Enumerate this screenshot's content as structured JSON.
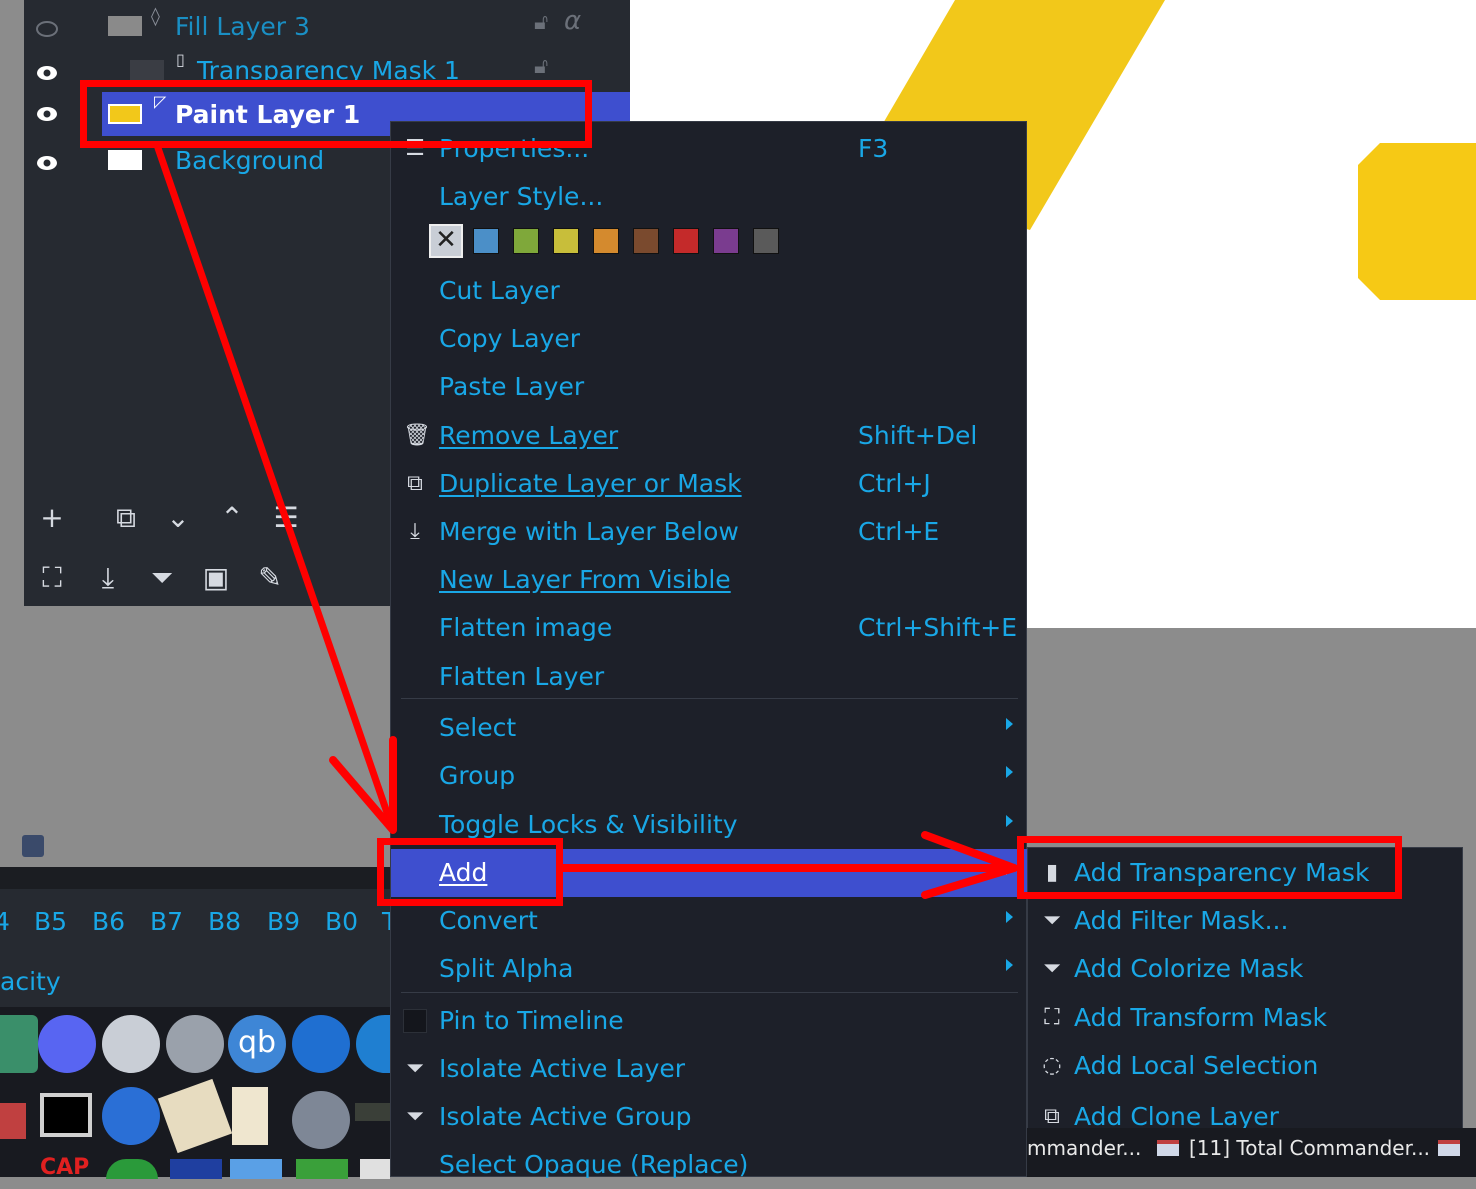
{
  "layers": [
    {
      "name": "Fill Layer 3",
      "selected": false
    },
    {
      "name": "Transparency Mask 1",
      "selected": false
    },
    {
      "name": "Paint Layer 1",
      "selected": true
    },
    {
      "name": "Background",
      "selected": false
    }
  ],
  "brush_tabs": [
    "4",
    "B5",
    "B6",
    "B7",
    "B8",
    "B9",
    "B0",
    "T"
  ],
  "opacity_label": "acity",
  "context_menu": {
    "properties": {
      "label": "Properties...",
      "shortcut": "F3"
    },
    "layer_style": "Layer Style...",
    "color_labels": [
      "#4b8fc8",
      "#7fa83a",
      "#c8be3a",
      "#d48a2e",
      "#7a4a2e",
      "#c42a2a",
      "#7a3c8f",
      "#5a5a5a"
    ],
    "cut": "Cut Layer",
    "copy": "Copy Layer",
    "paste": "Paste Layer",
    "remove": {
      "label": "Remove Layer",
      "shortcut": "Shift+Del"
    },
    "duplicate": {
      "label": "Duplicate Layer or Mask",
      "shortcut": "Ctrl+J"
    },
    "merge": {
      "label": "Merge with Layer Below",
      "shortcut": "Ctrl+E"
    },
    "new_from_visible": "New Layer From Visible",
    "flatten_image": {
      "label": "Flatten image",
      "shortcut": "Ctrl+Shift+E"
    },
    "flatten_layer": "Flatten Layer",
    "select": "Select",
    "group": "Group",
    "toggle": "Toggle Locks & Visibility",
    "add": "Add",
    "convert": "Convert",
    "split_alpha": "Split Alpha",
    "pin": "Pin to Timeline",
    "isolate_layer": "Isolate Active Layer",
    "isolate_group": "Isolate Active Group",
    "select_opaque": "Select Opaque (Replace)"
  },
  "add_submenu": [
    {
      "label": "Add Transparency Mask",
      "icon": "transparency-mask-icon"
    },
    {
      "label": "Add Filter Mask...",
      "icon": "filter-icon"
    },
    {
      "label": "Add Colorize Mask",
      "icon": "filter-icon"
    },
    {
      "label": "Add Transform Mask",
      "icon": "transform-icon"
    },
    {
      "label": "Add Local Selection",
      "icon": "selection-icon"
    },
    {
      "label": "Add Clone Layer",
      "icon": "clone-icon"
    }
  ],
  "taskbar_right": {
    "item1": "mmander...",
    "item2": "[11] Total Commander..."
  },
  "colors": {
    "accent": "#19a7e6",
    "highlight": "#3e4fcf",
    "annotation": "#ff0000",
    "menu_bg": "#1d2029"
  }
}
